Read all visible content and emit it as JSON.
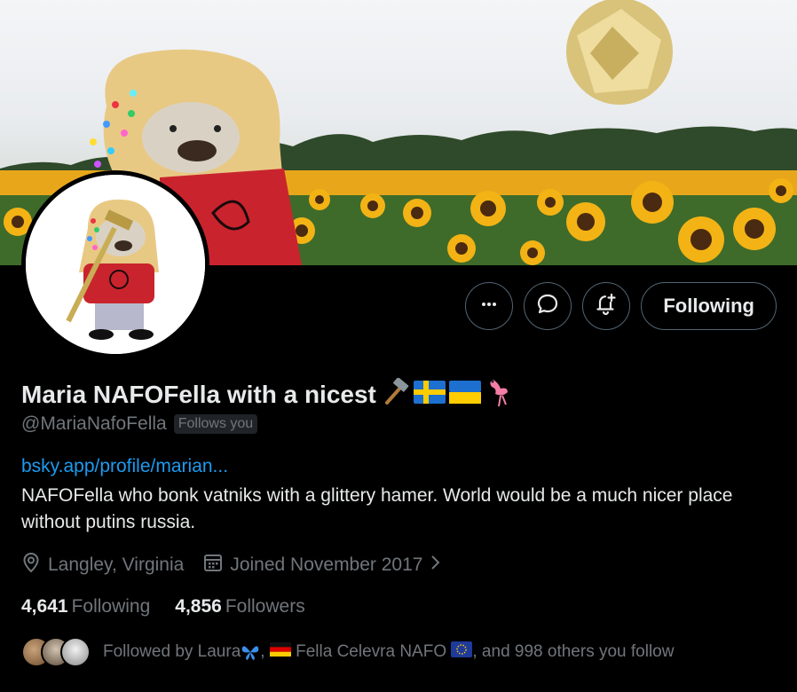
{
  "profile": {
    "display_name": "Maria NAFOFella with a nicest",
    "handle": "@MariaNafoFella",
    "follows_you_badge": "Follows you",
    "link": "bsky.app/profile/marian...",
    "bio": "NAFOFella who bonk vatniks with a glittery hamer. World would be a much nicer place without putins russia.",
    "location": "Langley, Virginia",
    "joined": "Joined November 2017",
    "name_emojis": [
      "hammer-emoji",
      "sweden-flag-emoji",
      "ukraine-flag-emoji",
      "flamingo-emoji"
    ]
  },
  "actions": {
    "more_icon": "more-dots-icon",
    "message_icon": "message-icon",
    "notify_icon": "bell-plus-icon",
    "following_label": "Following"
  },
  "stats": {
    "following_count": "4,641",
    "following_label": "Following",
    "followers_count": "4,856",
    "followers_label": "Followers"
  },
  "followed_by": {
    "prefix": "Followed by Laura",
    "middle": ", ",
    "second": " Fella Celevra NAFO ",
    "suffix": ", and 998 others you follow"
  },
  "colors": {
    "background": "#000000",
    "text_primary": "#e7e9ea",
    "text_secondary": "#71767b",
    "link": "#1d9bf0",
    "border": "#536471"
  }
}
